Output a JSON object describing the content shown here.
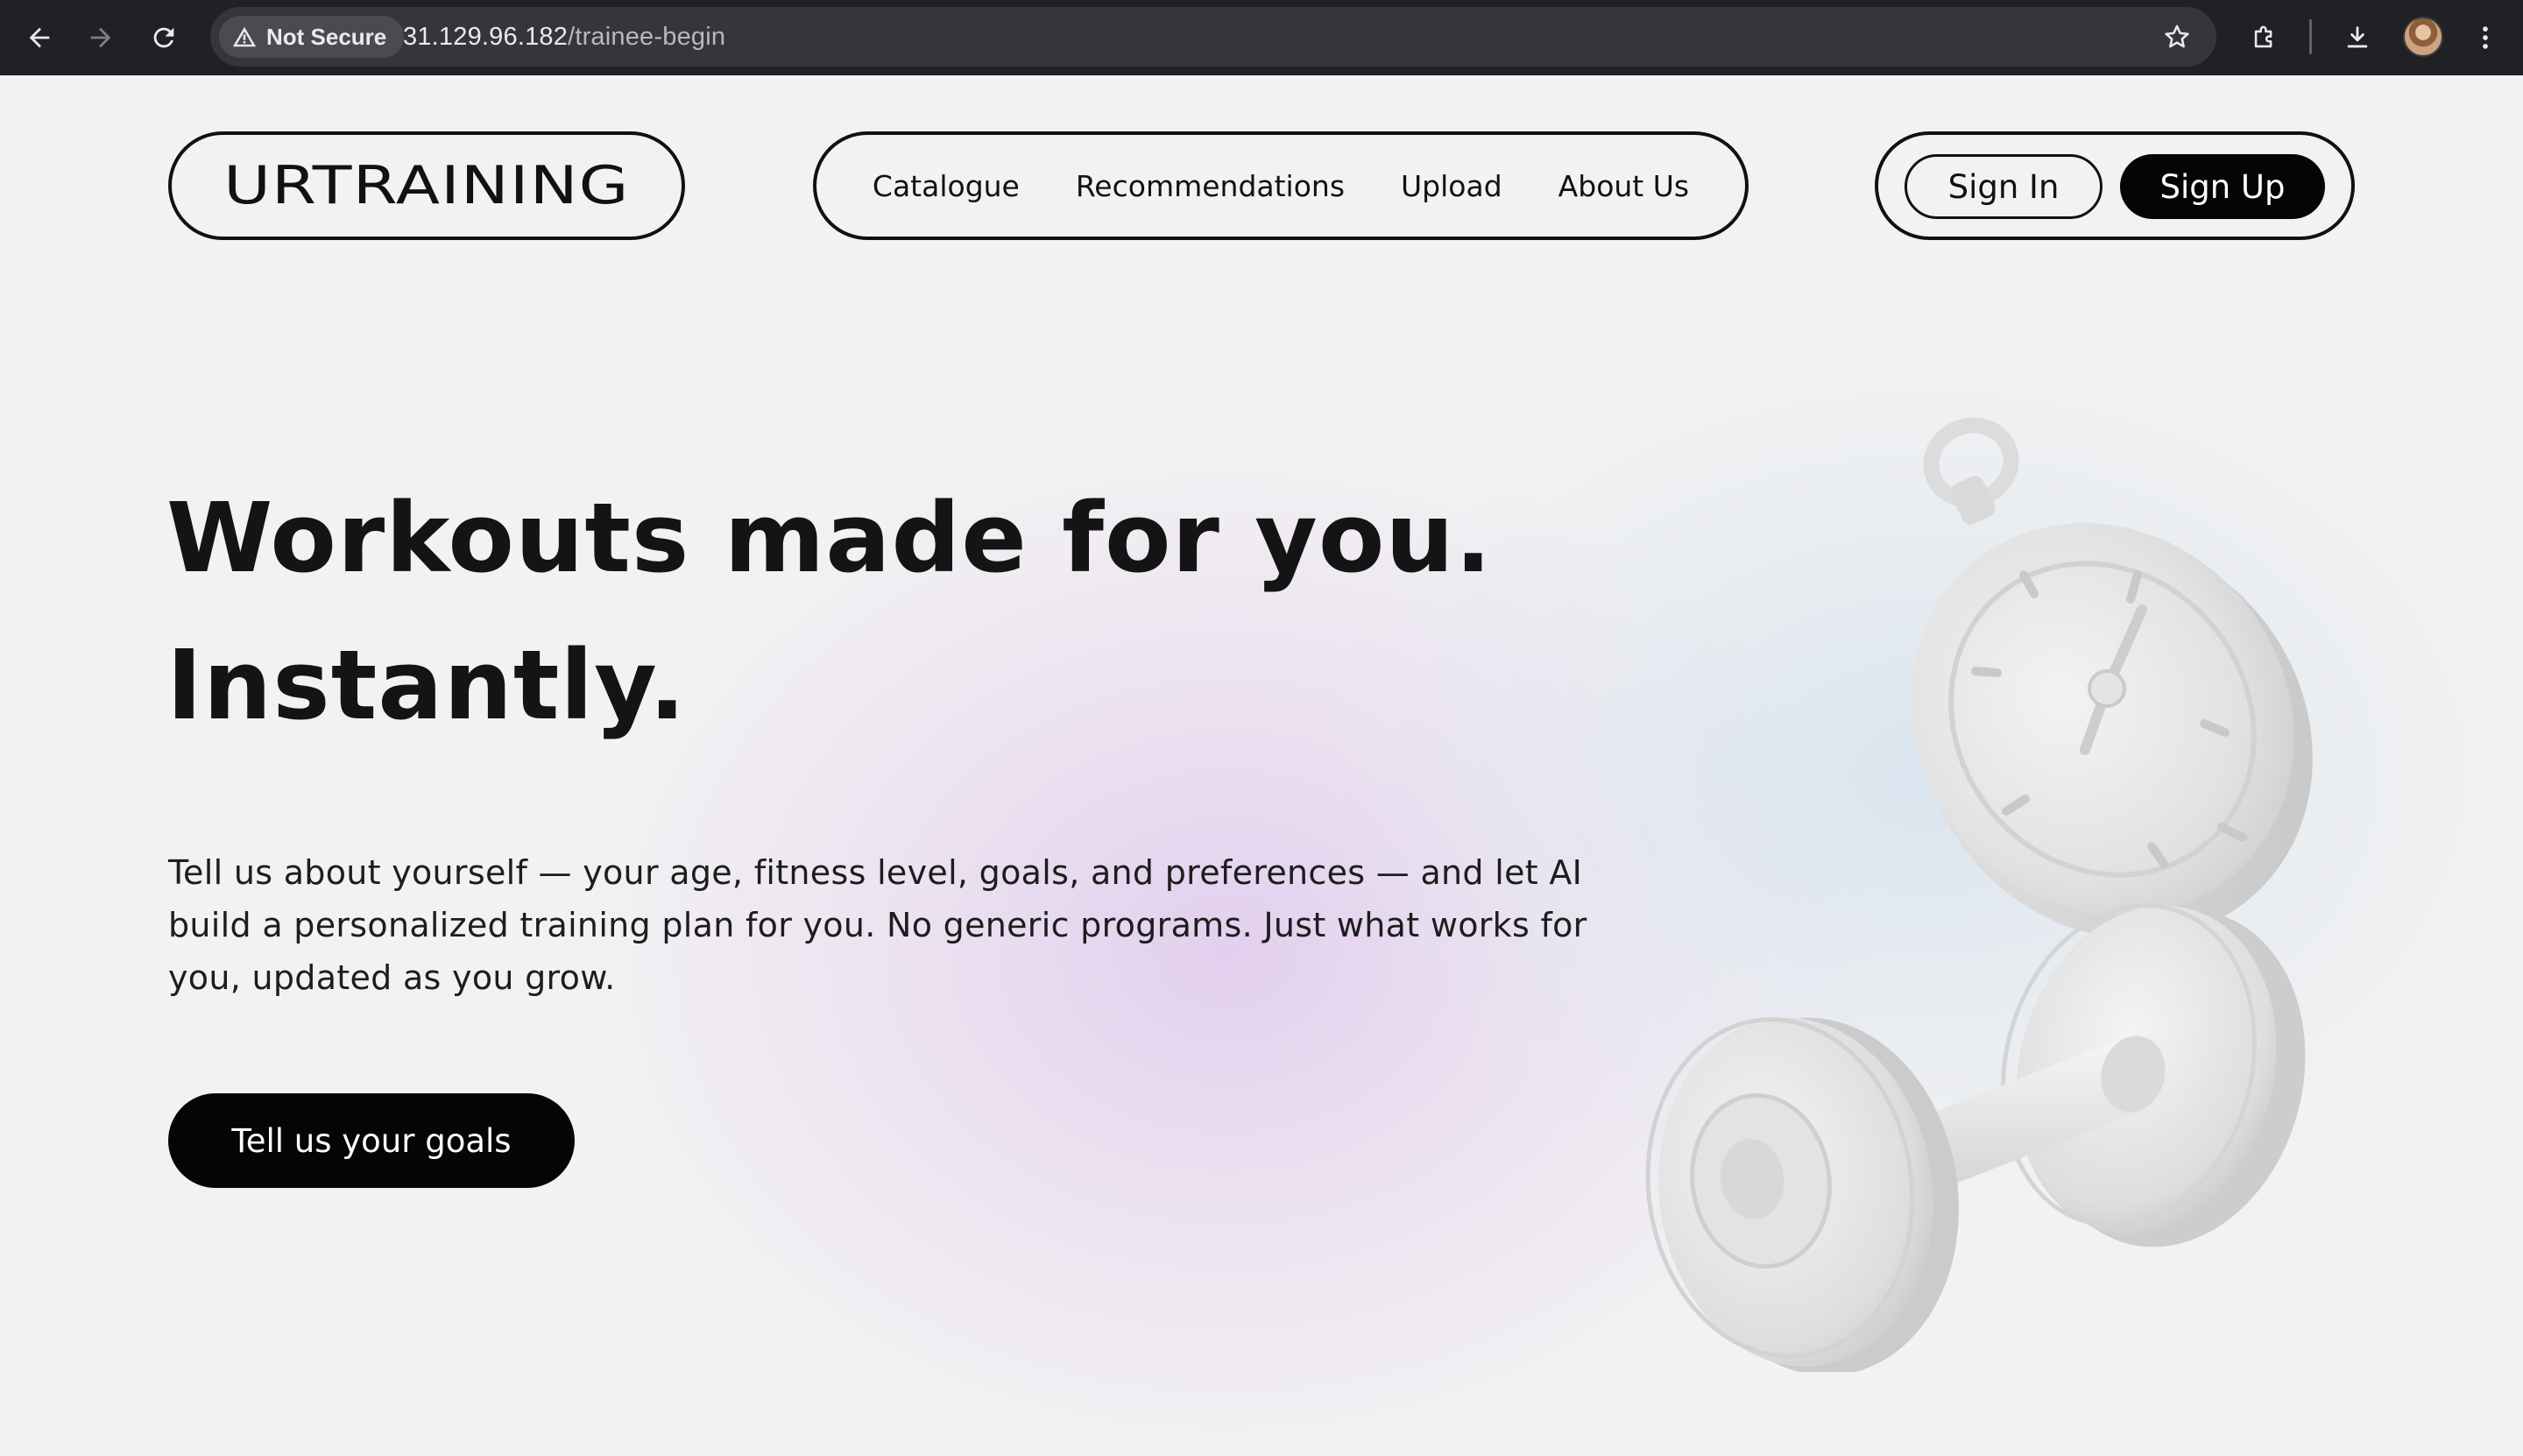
{
  "browser": {
    "security_label": "Not Secure",
    "url_host": "31.129.96.182",
    "url_path": "/trainee-begin"
  },
  "header": {
    "logo": "URTRAINING",
    "nav": [
      {
        "label": "Catalogue"
      },
      {
        "label": "Recommendations"
      },
      {
        "label": "Upload"
      },
      {
        "label": "About Us"
      }
    ],
    "sign_in_label": "Sign In",
    "sign_up_label": "Sign Up"
  },
  "hero": {
    "title_line1": "Workouts made for you.",
    "title_line2": "Instantly.",
    "description": "Tell us about yourself — your age, fitness level, goals, and preferences — and let AI build a personalized training plan for you. No generic programs. Just what works for you, updated as you grow.",
    "cta_label": "Tell us your goals"
  },
  "colors": {
    "background": "#f2f2f2",
    "ink": "#111111",
    "button": "#050505",
    "accent_glow_purple": "#e1cdee",
    "accent_glow_blue": "#d6e2ee"
  },
  "icons": {
    "back": "arrow-left-icon",
    "forward": "arrow-right-icon",
    "reload": "reload-icon",
    "warning": "warning-triangle-icon",
    "bookmark": "star-icon",
    "extensions": "puzzle-icon",
    "download": "download-icon",
    "menu": "kebab-menu-icon",
    "hero_art": "stopwatch-and-dumbbell-illustration"
  }
}
